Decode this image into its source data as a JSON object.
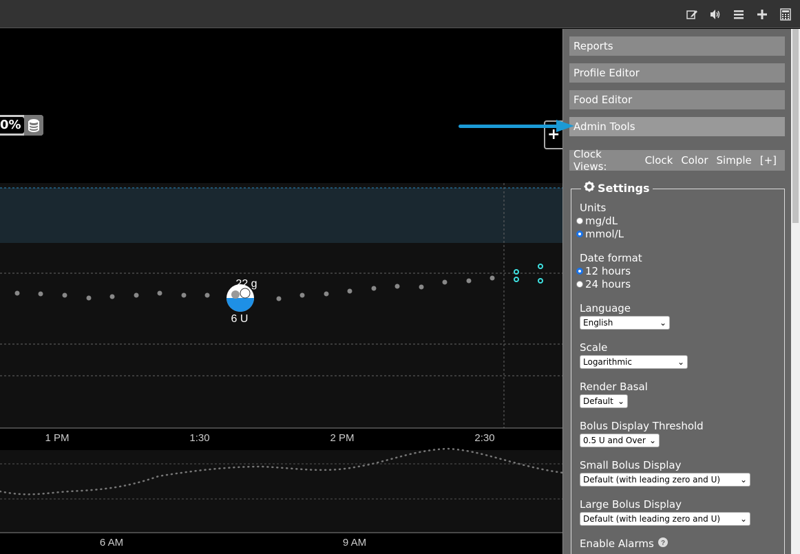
{
  "topbar": {
    "icons": [
      "edit-icon",
      "volume-icon",
      "menu-icon",
      "plus-icon",
      "calculator-icon"
    ]
  },
  "chart": {
    "pill_text": "0%",
    "carb_label": "22 g",
    "insulin_label": "6 U",
    "x_ticks_main": [
      "1 PM",
      "1:30",
      "2 PM",
      "2:30"
    ],
    "x_ticks_sub": [
      "6 AM",
      "9 AM"
    ]
  },
  "panel": {
    "menu": [
      "Reports",
      "Profile Editor",
      "Food Editor",
      "Admin Tools"
    ],
    "clock_views": {
      "label": "Clock Views:",
      "options": [
        "Clock",
        "Color",
        "Simple"
      ],
      "add": "[+]"
    },
    "settings": {
      "title": "Settings",
      "units": {
        "label": "Units",
        "options": [
          "mg/dL",
          "mmol/L"
        ],
        "selected": "mmol/L"
      },
      "date_format": {
        "label": "Date format",
        "options": [
          "12 hours",
          "24 hours"
        ],
        "selected": "12 hours"
      },
      "language": {
        "label": "Language",
        "value": "English"
      },
      "scale": {
        "label": "Scale",
        "value": "Logarithmic"
      },
      "render_basal": {
        "label": "Render Basal",
        "value": "Default"
      },
      "bolus_threshold": {
        "label": "Bolus Display Threshold",
        "value": "0.5 U and Over"
      },
      "small_bolus": {
        "label": "Small Bolus Display",
        "value": "Default (with leading zero and U)"
      },
      "large_bolus": {
        "label": "Large Bolus Display",
        "value": "Default (with leading zero and U)"
      },
      "enable_alarms": {
        "label": "Enable Alarms"
      }
    }
  }
}
